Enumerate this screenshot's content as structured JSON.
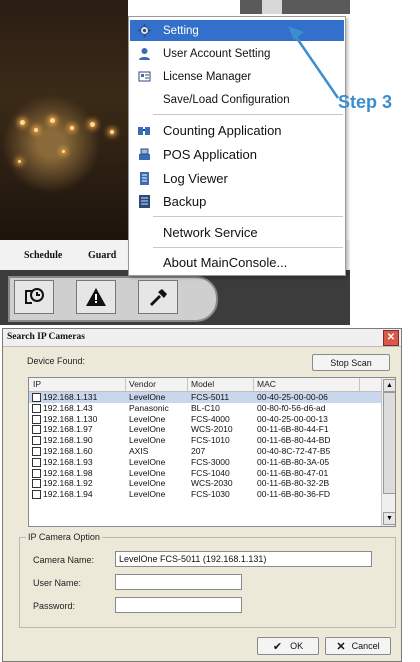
{
  "top": {
    "tabs": [
      "Schedule",
      "Guard"
    ],
    "context_menu": [
      {
        "label": "Setting",
        "icon": "gear-icon",
        "highlighted": true
      },
      {
        "label": "User Account Setting",
        "icon": "user-icon"
      },
      {
        "label": "License Manager",
        "icon": "license-icon"
      },
      {
        "label": "Save/Load Configuration",
        "icon": ""
      },
      {
        "label": "Counting Application",
        "icon": "counting-icon",
        "separator_before": true
      },
      {
        "label": "POS Application",
        "icon": "pos-icon"
      },
      {
        "label": "Log Viewer",
        "icon": "log-icon"
      },
      {
        "label": "Backup",
        "icon": "backup-icon"
      },
      {
        "label": "Network Service",
        "icon": "",
        "separator_before": true
      },
      {
        "label": "About MainConsole...",
        "icon": "",
        "separator_before": true
      }
    ],
    "annotation": "Step 3",
    "accent_color": "#3370cc"
  },
  "dialog": {
    "title": "Search IP Cameras",
    "device_found_label": "Device Found:",
    "stop_scan_label": "Stop Scan",
    "columns": [
      "IP",
      "Vendor",
      "Model",
      "MAC"
    ],
    "rows": [
      [
        "192.168.1.131",
        "LevelOne",
        "FCS-5011",
        "00-40-25-00-00-06"
      ],
      [
        "192.168.1.43",
        "Panasonic",
        "BL-C10",
        "00-80-f0-56-d6-ad"
      ],
      [
        "192.168.1.130",
        "LevelOne",
        "FCS-4000",
        "00-40-25-00-00-13"
      ],
      [
        "192.168.1.97",
        "LevelOne",
        "WCS-2010",
        "00-11-6B-80-44-F1"
      ],
      [
        "192.168.1.90",
        "LevelOne",
        "FCS-1010",
        "00-11-6B-80-44-BD"
      ],
      [
        "192.168.1.60",
        "AXIS",
        "207",
        "00-40-8C-72-47-B5"
      ],
      [
        "192.168.1.93",
        "LevelOne",
        "FCS-3000",
        "00-11-6B-80-3A-05"
      ],
      [
        "192.168.1.98",
        "LevelOne",
        "FCS-1040",
        "00-11-6B-80-47-01"
      ],
      [
        "192.168.1.92",
        "LevelOne",
        "WCS-2030",
        "00-11-6B-80-32-2B"
      ],
      [
        "192.168.1.94",
        "LevelOne",
        "FCS-1030",
        "00-11-6B-80-36-FD"
      ]
    ],
    "ip_camera_option_label": "IP Camera Option",
    "camera_name_label": "Camera Name:",
    "camera_name_value": "LevelOne FCS-5011 (192.168.1.131)",
    "user_name_label": "User Name:",
    "user_name_value": "",
    "password_label": "Password:",
    "password_value": "",
    "ok_label": "OK",
    "cancel_label": "Cancel"
  }
}
